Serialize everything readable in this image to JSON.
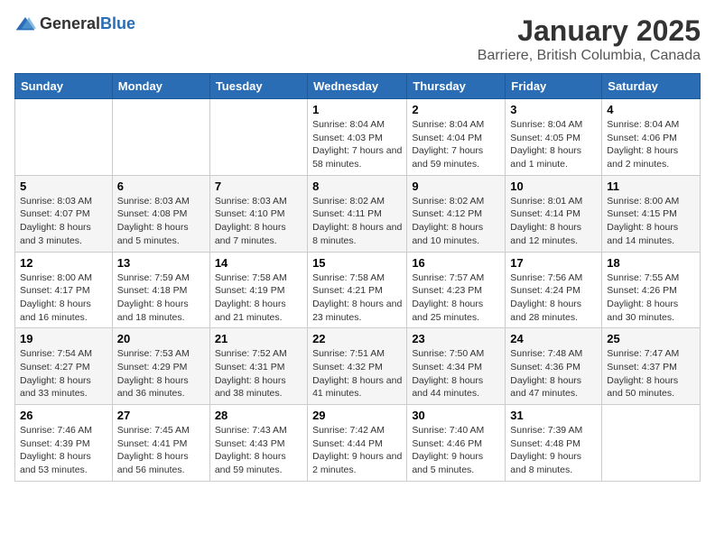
{
  "header": {
    "logo_general": "General",
    "logo_blue": "Blue",
    "month": "January 2025",
    "location": "Barriere, British Columbia, Canada"
  },
  "weekdays": [
    "Sunday",
    "Monday",
    "Tuesday",
    "Wednesday",
    "Thursday",
    "Friday",
    "Saturday"
  ],
  "weeks": [
    [
      {
        "day": "",
        "info": ""
      },
      {
        "day": "",
        "info": ""
      },
      {
        "day": "",
        "info": ""
      },
      {
        "day": "1",
        "info": "Sunrise: 8:04 AM\nSunset: 4:03 PM\nDaylight: 7 hours and 58 minutes."
      },
      {
        "day": "2",
        "info": "Sunrise: 8:04 AM\nSunset: 4:04 PM\nDaylight: 7 hours and 59 minutes."
      },
      {
        "day": "3",
        "info": "Sunrise: 8:04 AM\nSunset: 4:05 PM\nDaylight: 8 hours and 1 minute."
      },
      {
        "day": "4",
        "info": "Sunrise: 8:04 AM\nSunset: 4:06 PM\nDaylight: 8 hours and 2 minutes."
      }
    ],
    [
      {
        "day": "5",
        "info": "Sunrise: 8:03 AM\nSunset: 4:07 PM\nDaylight: 8 hours and 3 minutes."
      },
      {
        "day": "6",
        "info": "Sunrise: 8:03 AM\nSunset: 4:08 PM\nDaylight: 8 hours and 5 minutes."
      },
      {
        "day": "7",
        "info": "Sunrise: 8:03 AM\nSunset: 4:10 PM\nDaylight: 8 hours and 7 minutes."
      },
      {
        "day": "8",
        "info": "Sunrise: 8:02 AM\nSunset: 4:11 PM\nDaylight: 8 hours and 8 minutes."
      },
      {
        "day": "9",
        "info": "Sunrise: 8:02 AM\nSunset: 4:12 PM\nDaylight: 8 hours and 10 minutes."
      },
      {
        "day": "10",
        "info": "Sunrise: 8:01 AM\nSunset: 4:14 PM\nDaylight: 8 hours and 12 minutes."
      },
      {
        "day": "11",
        "info": "Sunrise: 8:00 AM\nSunset: 4:15 PM\nDaylight: 8 hours and 14 minutes."
      }
    ],
    [
      {
        "day": "12",
        "info": "Sunrise: 8:00 AM\nSunset: 4:17 PM\nDaylight: 8 hours and 16 minutes."
      },
      {
        "day": "13",
        "info": "Sunrise: 7:59 AM\nSunset: 4:18 PM\nDaylight: 8 hours and 18 minutes."
      },
      {
        "day": "14",
        "info": "Sunrise: 7:58 AM\nSunset: 4:19 PM\nDaylight: 8 hours and 21 minutes."
      },
      {
        "day": "15",
        "info": "Sunrise: 7:58 AM\nSunset: 4:21 PM\nDaylight: 8 hours and 23 minutes."
      },
      {
        "day": "16",
        "info": "Sunrise: 7:57 AM\nSunset: 4:23 PM\nDaylight: 8 hours and 25 minutes."
      },
      {
        "day": "17",
        "info": "Sunrise: 7:56 AM\nSunset: 4:24 PM\nDaylight: 8 hours and 28 minutes."
      },
      {
        "day": "18",
        "info": "Sunrise: 7:55 AM\nSunset: 4:26 PM\nDaylight: 8 hours and 30 minutes."
      }
    ],
    [
      {
        "day": "19",
        "info": "Sunrise: 7:54 AM\nSunset: 4:27 PM\nDaylight: 8 hours and 33 minutes."
      },
      {
        "day": "20",
        "info": "Sunrise: 7:53 AM\nSunset: 4:29 PM\nDaylight: 8 hours and 36 minutes."
      },
      {
        "day": "21",
        "info": "Sunrise: 7:52 AM\nSunset: 4:31 PM\nDaylight: 8 hours and 38 minutes."
      },
      {
        "day": "22",
        "info": "Sunrise: 7:51 AM\nSunset: 4:32 PM\nDaylight: 8 hours and 41 minutes."
      },
      {
        "day": "23",
        "info": "Sunrise: 7:50 AM\nSunset: 4:34 PM\nDaylight: 8 hours and 44 minutes."
      },
      {
        "day": "24",
        "info": "Sunrise: 7:48 AM\nSunset: 4:36 PM\nDaylight: 8 hours and 47 minutes."
      },
      {
        "day": "25",
        "info": "Sunrise: 7:47 AM\nSunset: 4:37 PM\nDaylight: 8 hours and 50 minutes."
      }
    ],
    [
      {
        "day": "26",
        "info": "Sunrise: 7:46 AM\nSunset: 4:39 PM\nDaylight: 8 hours and 53 minutes."
      },
      {
        "day": "27",
        "info": "Sunrise: 7:45 AM\nSunset: 4:41 PM\nDaylight: 8 hours and 56 minutes."
      },
      {
        "day": "28",
        "info": "Sunrise: 7:43 AM\nSunset: 4:43 PM\nDaylight: 8 hours and 59 minutes."
      },
      {
        "day": "29",
        "info": "Sunrise: 7:42 AM\nSunset: 4:44 PM\nDaylight: 9 hours and 2 minutes."
      },
      {
        "day": "30",
        "info": "Sunrise: 7:40 AM\nSunset: 4:46 PM\nDaylight: 9 hours and 5 minutes."
      },
      {
        "day": "31",
        "info": "Sunrise: 7:39 AM\nSunset: 4:48 PM\nDaylight: 9 hours and 8 minutes."
      },
      {
        "day": "",
        "info": ""
      }
    ]
  ]
}
